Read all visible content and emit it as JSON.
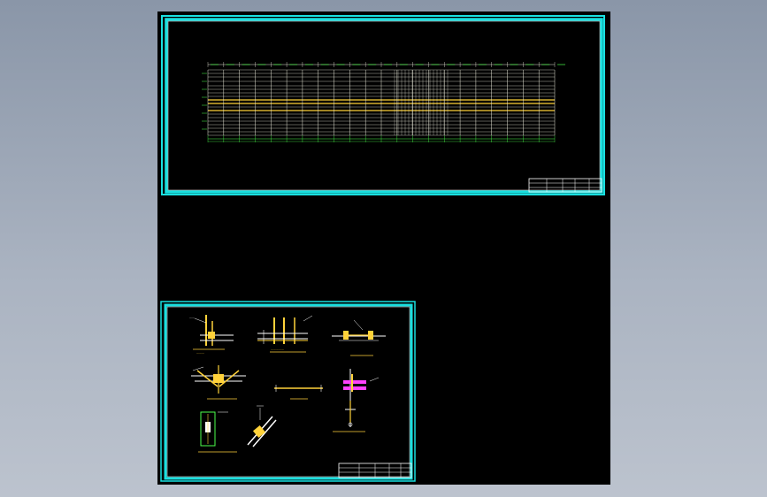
{
  "app": {
    "title": "",
    "background_top": "#8a96a8",
    "background_bottom": "#bcc3ce",
    "canvas_color": "#000000"
  },
  "colors": {
    "frame": "#19e0e0",
    "frame_inner": "#ffffff",
    "grid": "#e8e8d8",
    "member": "#ffd23a",
    "annotation": "#4cff4c",
    "section": "#ff40ff"
  },
  "sheets": [
    {
      "id": "sheet-1",
      "name": "main-elevation-sheet"
    },
    {
      "id": "sheet-2",
      "name": "detail-sheet"
    }
  ]
}
